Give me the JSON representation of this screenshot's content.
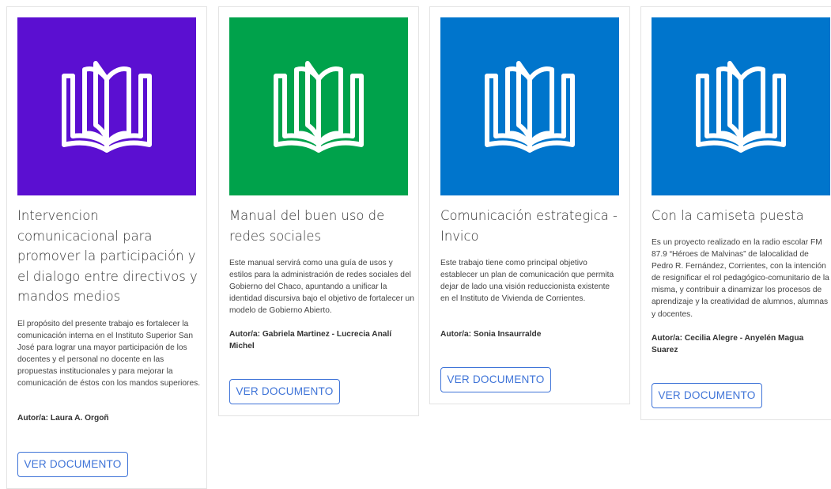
{
  "colors": {
    "purple": "#5b0fd1",
    "green": "#00a24b",
    "blue": "#0075cc",
    "button": "#3f74d8"
  },
  "cards": [
    {
      "icon": "open-book-icon",
      "title": "Intervencion comunicacional para promover la participación y el dialogo entre directivos y mandos medios",
      "description": "El propósito del presente trabajo es fortalecer la comunicación interna en el Instituto Superior San José para lograr una mayor participación de los docentes y el personal no docente en las propuestas institucionales y para mejorar la comunicación de éstos con los mandos superiores.",
      "author": "Autor/a: Laura A. Orgoñ",
      "button": "VER DOCUMENTO"
    },
    {
      "icon": "open-book-icon",
      "title": "Manual del buen uso de redes sociales",
      "description": "Este manual servirá como una guía de usos y estilos para la administración de redes sociales del Gobierno del Chaco, apuntando a unificar la identidad discursiva bajo el objetivo de fortalecer un modelo de Gobierno Abierto.",
      "author": "Autor/a: Gabriela Martinez - Lucrecia Analí Michel",
      "button": "VER DOCUMENTO"
    },
    {
      "icon": "open-book-icon",
      "title": "Comunicación estrategica - Invico",
      "description": "Este trabajo tiene como principal objetivo establecer un plan de comunicación que permita dejar de lado una visión reduccionista existente en el Instituto de Vivienda de Corrientes.",
      "author": "Autor/a: Sonia Insaurralde",
      "button": "VER DOCUMENTO"
    },
    {
      "icon": "open-book-icon",
      "title": "Con la camiseta puesta",
      "description": "Es un proyecto realizado en la radio escolar FM 87.9 “Héroes de Malvinas” de lalocalidad de Pedro R. Fernández, Corrientes, con la intención de resignificar el rol pedagógico-comunitario de la misma, y contribuir a dinamizar los procesos de aprendizaje y la creatividad de alumnos, alumnas y docentes.",
      "author": "Autor/a: Cecilia Alegre - Anyelén Magua Suarez",
      "button": "VER DOCUMENTO"
    }
  ]
}
